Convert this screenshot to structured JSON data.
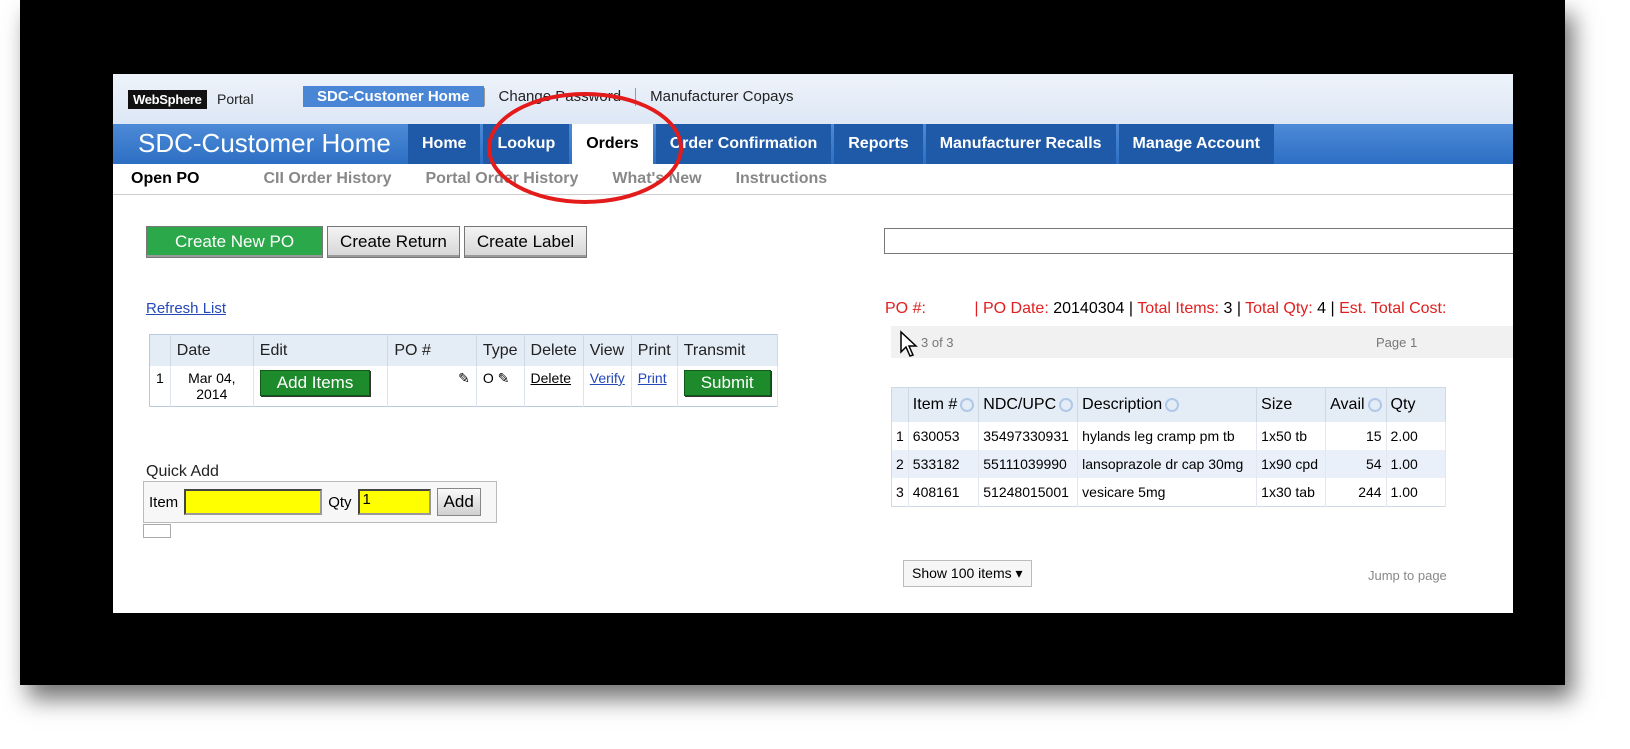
{
  "portal": {
    "logo": "WebSphere",
    "portal_label": "Portal"
  },
  "top_links": [
    "SDC-Customer Home",
    "Change Password",
    "Manufacturer Copays"
  ],
  "app_title": "SDC-Customer Home",
  "tabs": [
    "Home",
    "Lookup",
    "Orders",
    "Order Confirmation",
    "Reports",
    "Manufacturer Recalls",
    "Manage Account"
  ],
  "subnav": [
    "Open PO",
    "CII Order History",
    "Portal Order History",
    "What's New",
    "Instructions"
  ],
  "actions": {
    "create_new_po": "Create New PO",
    "create_return": "Create Return",
    "create_label": "Create Label"
  },
  "refresh_link": "Refresh List",
  "po_table": {
    "headers": [
      "Date",
      "Edit",
      "PO #",
      "Type",
      "Delete",
      "View",
      "Print",
      "Transmit"
    ],
    "rows": [
      {
        "num": "1",
        "date": "Mar 04, 2014",
        "edit": "Add Items",
        "type_mark": "O",
        "delete": "Delete",
        "view": "Verify",
        "print": "Print",
        "transmit": "Submit"
      }
    ]
  },
  "quick_add": {
    "title": "Quick Add",
    "item_label": "Item",
    "item_value": "",
    "qty_label": "Qty",
    "qty_value": "1",
    "add_label": "Add"
  },
  "po_info": {
    "po_label": "PO #:",
    "po_date_label": "PO Date:",
    "po_date": "20140304",
    "total_items_label": "Total Items:",
    "total_items": "3",
    "total_qty_label": "Total Qty:",
    "total_qty": "4",
    "est_cost_label": "Est. Total Cost:"
  },
  "pager": {
    "count": "3 of 3",
    "page": "Page 1"
  },
  "items_table": {
    "headers": [
      "Item #",
      "NDC/UPC",
      "Description",
      "Size",
      "Avail",
      "Qty"
    ],
    "rows": [
      {
        "n": "1",
        "item": "630053",
        "ndc": "35497330931",
        "desc": "hylands leg cramp pm tb",
        "size": "1x50 tb",
        "avail": "15",
        "qty": "2.00"
      },
      {
        "n": "2",
        "item": "533182",
        "ndc": "55111039990",
        "desc": "lansoprazole dr cap 30mg",
        "size": "1x90 cpd",
        "avail": "54",
        "qty": "1.00"
      },
      {
        "n": "3",
        "item": "408161",
        "ndc": "51248015001",
        "desc": "vesicare 5mg",
        "size": "1x30 tab",
        "avail": "244",
        "qty": "1.00"
      }
    ]
  },
  "show_items": "Show 100 items",
  "jump_to_page": "Jump to page",
  "annotation_color": "#e31b1b"
}
